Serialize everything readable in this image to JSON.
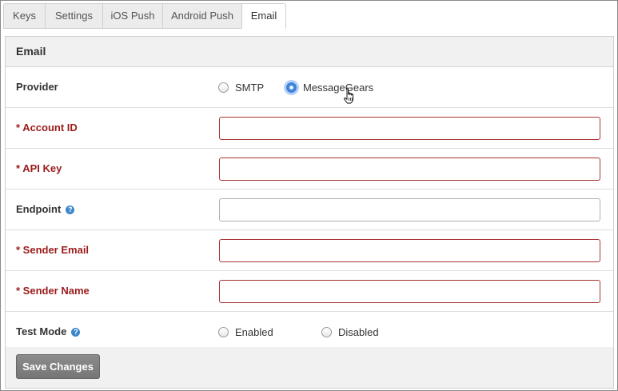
{
  "tabs": [
    {
      "label": "Keys",
      "active": false
    },
    {
      "label": "Settings",
      "active": false
    },
    {
      "label": "iOS Push",
      "active": false
    },
    {
      "label": "Android Push",
      "active": false
    },
    {
      "label": "Email",
      "active": true
    }
  ],
  "panel": {
    "title": "Email",
    "provider": {
      "label": "Provider",
      "options": [
        {
          "label": "SMTP",
          "checked": false
        },
        {
          "label": "MessageGears",
          "checked": true
        }
      ]
    },
    "fields": [
      {
        "label": "* Account ID",
        "required": true,
        "value": "",
        "placeholder": ""
      },
      {
        "label": "* API Key",
        "required": true,
        "value": "",
        "placeholder": ""
      },
      {
        "label": "Endpoint",
        "required": false,
        "help": true,
        "value": "",
        "placeholder": ""
      },
      {
        "label": "* Sender Email",
        "required": true,
        "value": "",
        "placeholder": ""
      },
      {
        "label": "* Sender Name",
        "required": true,
        "value": "",
        "placeholder": ""
      }
    ],
    "test_mode": {
      "label": "Test Mode",
      "options": [
        {
          "label": "Enabled",
          "checked": false
        },
        {
          "label": "Disabled",
          "checked": false
        }
      ]
    },
    "help_glyph": "?",
    "save_label": "Save Changes"
  },
  "colors": {
    "required_label": "#9b1b1b",
    "invalid_border": "#aa3333",
    "help_icon": "#3d86c9",
    "radio_selected": "#2f74d0",
    "save_button": "#808080"
  },
  "icons": {
    "help": "help-icon",
    "cursor": "hand-pointer-icon"
  }
}
